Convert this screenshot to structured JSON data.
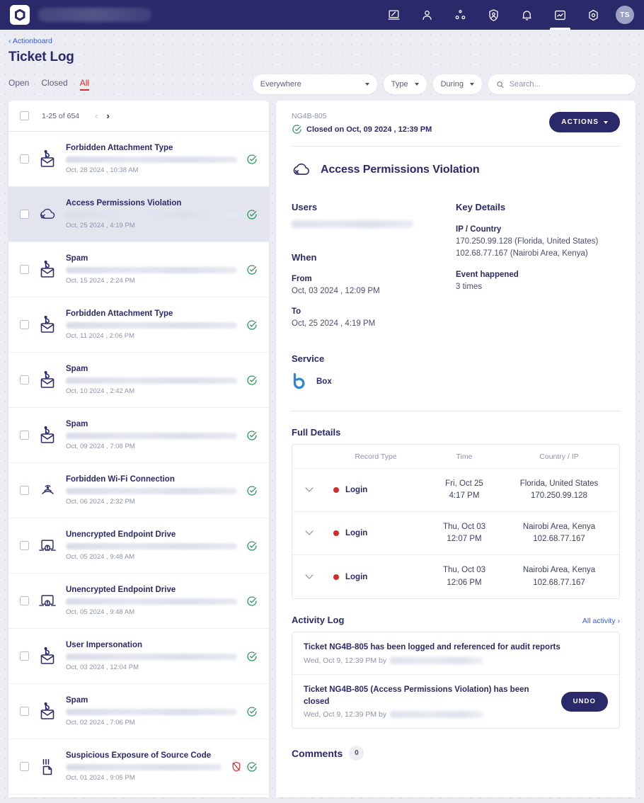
{
  "topbar": {
    "logo_name": "app-logo",
    "org_masked": true,
    "nav": [
      {
        "name": "devices-icon",
        "icon": "laptop"
      },
      {
        "name": "users-icon",
        "icon": "person"
      },
      {
        "name": "integrations-icon",
        "icon": "nodes"
      },
      {
        "name": "threats-icon",
        "icon": "shield-person"
      },
      {
        "name": "alerts-icon",
        "icon": "bell"
      },
      {
        "name": "actionboard-icon",
        "icon": "chart-box",
        "active": true
      },
      {
        "name": "settings-icon",
        "icon": "gear"
      }
    ],
    "avatar_initials": "TS"
  },
  "breadcrumb": "‹ Actionboard",
  "page_title": "Ticket Log",
  "tabs": [
    {
      "label": "Open",
      "selected": false
    },
    {
      "label": "Closed",
      "selected": false
    },
    {
      "label": "All",
      "selected": true
    }
  ],
  "filters": {
    "scope": "Everywhere",
    "type": "Type",
    "during": "During",
    "search_placeholder": "Search...",
    "search_value": ""
  },
  "list": {
    "pagination": "1-25 of 654",
    "prev": "‹",
    "next": "›",
    "rows": [
      {
        "title": "Forbidden Attachment Type",
        "time": "Oct, 28 2024 , 10:38 AM",
        "icon": "mail-alert-icon",
        "closed": true,
        "blocked": false,
        "active": false
      },
      {
        "title": "Access Permissions Violation",
        "time": "Oct, 25 2024 , 4:19 PM",
        "icon": "cloud-access-icon",
        "closed": true,
        "blocked": false,
        "active": true
      },
      {
        "title": "Spam",
        "time": "Oct, 15 2024 , 2:24 PM",
        "icon": "mail-alert-icon",
        "closed": true,
        "blocked": false,
        "active": false
      },
      {
        "title": "Forbidden Attachment Type",
        "time": "Oct, 11 2024 , 2:06 PM",
        "icon": "mail-alert-icon",
        "closed": true,
        "blocked": false,
        "active": false
      },
      {
        "title": "Spam",
        "time": "Oct, 10 2024 , 2:42 AM",
        "icon": "mail-alert-icon",
        "closed": true,
        "blocked": false,
        "active": false
      },
      {
        "title": "Spam",
        "time": "Oct, 09 2024 , 7:08 PM",
        "icon": "mail-alert-icon",
        "closed": true,
        "blocked": false,
        "active": false
      },
      {
        "title": "Forbidden Wi-Fi Connection",
        "time": "Oct, 06 2024 , 2:32 PM",
        "icon": "wifi-icon",
        "closed": true,
        "blocked": false,
        "active": false
      },
      {
        "title": "Unencrypted Endpoint Drive",
        "time": "Oct, 05 2024 , 9:48 AM",
        "icon": "monitor-alert-icon",
        "closed": true,
        "blocked": false,
        "active": false
      },
      {
        "title": "Unencrypted Endpoint Drive",
        "time": "Oct, 05 2024 , 9:48 AM",
        "icon": "monitor-alert-icon",
        "closed": true,
        "blocked": false,
        "active": false
      },
      {
        "title": "User Impersonation",
        "time": "Oct, 03 2024 , 12:04 PM",
        "icon": "mail-alert-icon",
        "closed": true,
        "blocked": false,
        "active": false
      },
      {
        "title": "Spam",
        "time": "Oct, 02 2024 , 7:06 PM",
        "icon": "mail-alert-icon",
        "closed": true,
        "blocked": false,
        "active": false
      },
      {
        "title": "Suspicious Exposure of Source Code",
        "time": "Oct, 01 2024 , 9:05 PM",
        "icon": "source-code-icon",
        "closed": true,
        "blocked": true,
        "active": false
      }
    ]
  },
  "detail": {
    "ticket_id": "NG4B-805",
    "closed_status": "Closed on Oct, 09 2024 , 12:39 PM",
    "actions_label": "ACTIONS",
    "title": "Access Permissions Violation",
    "users_heading": "Users",
    "when_heading": "When",
    "from_label": "From",
    "from_value": "Oct, 03 2024 , 12:09 PM",
    "to_label": "To",
    "to_value": "Oct, 25 2024 , 4:19 PM",
    "service_heading": "Service",
    "service_name": "Box",
    "key_details_heading": "Key Details",
    "ip_country_label": "IP / Country",
    "ip_country_values": [
      "170.250.99.128 (Florida, United States)",
      "102.68.77.167 (Nairobi Area, Kenya)"
    ],
    "event_label": "Event happened",
    "event_value": "3 times",
    "full_details_heading": "Full Details",
    "table": {
      "columns": [
        "Record Type",
        "Time",
        "Country / IP"
      ],
      "rows": [
        {
          "type": "Login",
          "date": "Fri, Oct 25",
          "time": "4:17 PM",
          "country": "Florida, United States",
          "ip": "170.250.99.128"
        },
        {
          "type": "Login",
          "date": "Thu, Oct 03",
          "time": "12:07 PM",
          "country": "Nairobi Area, Kenya",
          "ip": "102.68.77.167"
        },
        {
          "type": "Login",
          "date": "Thu, Oct 03",
          "time": "12:06 PM",
          "country": "Nairobi Area, Kenya",
          "ip": "102.68.77.167"
        }
      ]
    },
    "activity_heading": "Activity Log",
    "all_activity_link": "All activity ›",
    "activity": [
      {
        "message": "Ticket NG4B-805 has been logged and referenced for audit reports",
        "meta": "Wed, Oct 9, 12:39 PM by",
        "undo": null
      },
      {
        "message": "Ticket NG4B-805 (Access Permissions Violation) has been closed",
        "meta": "Wed, Oct 9, 12:39 PM by",
        "undo": "UNDO"
      }
    ],
    "comments_heading": "Comments",
    "comments_count": "0"
  },
  "colors": {
    "brand_navy": "#2a2a6b",
    "accent_red": "#d42a2a",
    "success_green": "#2e9457",
    "link_blue": "#3b5bdb",
    "box_blue": "#2f86d1"
  }
}
